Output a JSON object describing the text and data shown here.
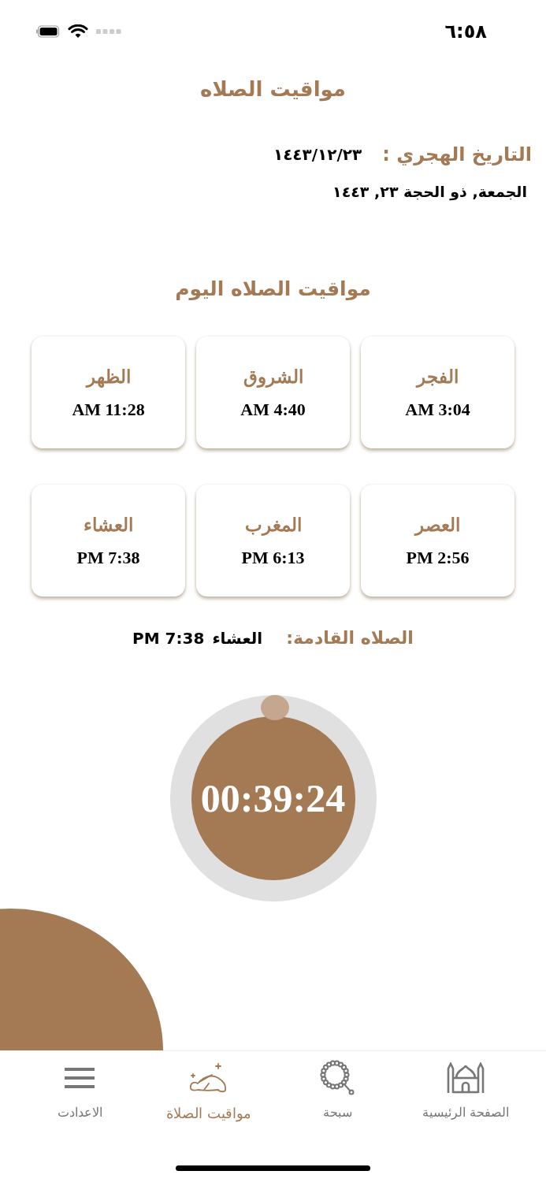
{
  "status_bar": {
    "time": "٦:٥٨"
  },
  "title": "مواقيت الصلاه",
  "hijri": {
    "label": "التاريخ الهجري :",
    "value": "١٤٤٣/١٢/٢٣"
  },
  "date_line": "الجمعة, ذو الحجة ٢٣, ١٤٤٣",
  "section_title": "مواقيت الصلاه اليوم",
  "prayers": [
    {
      "name": "الفجر",
      "time": "AM 3:04"
    },
    {
      "name": "الشروق",
      "time": "AM 4:40"
    },
    {
      "name": "الظهر",
      "time": "AM 11:28"
    },
    {
      "name": "العصر",
      "time": "PM 2:56"
    },
    {
      "name": "المغرب",
      "time": "PM 6:13"
    },
    {
      "name": "العشاء",
      "time": "PM 7:38"
    }
  ],
  "next_prayer": {
    "label": "الصلاه القادمة:",
    "name": "العشاء",
    "time": "PM 7:38"
  },
  "countdown": "00:39:24",
  "tab_bar": [
    {
      "kind": "home",
      "label": "الصفحة الرئيسية",
      "selected": false
    },
    {
      "kind": "beads",
      "label": "سبحة",
      "selected": false
    },
    {
      "kind": "prayer",
      "label": "مواقيت الصلاة",
      "selected": true
    },
    {
      "kind": "menu",
      "label": "الاعدادت",
      "selected": false
    }
  ]
}
